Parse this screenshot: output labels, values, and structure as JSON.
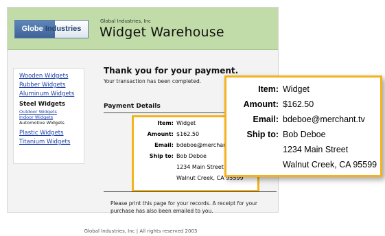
{
  "header": {
    "logo_word1": "Globe",
    "logo_word2": "Industries",
    "company": "Global Industries, Inc",
    "site_title": "Widget Warehouse"
  },
  "sidebar": {
    "items": [
      {
        "label": "Wooden Widgets"
      },
      {
        "label": "Rubber Widgets"
      },
      {
        "label": "Aluminum Widgets"
      }
    ],
    "current_group": "Steel Widgets",
    "subitems": [
      {
        "label": "Outdoor Widgets"
      },
      {
        "label": "Indoor Widgets"
      }
    ],
    "current_sub": "Automotive Widgets",
    "more_items": [
      {
        "label": "Plastic Widgets"
      },
      {
        "label": "Titanium Widgets"
      }
    ]
  },
  "main": {
    "thanks": "Thank you for your payment.",
    "completed": "Your transaction has been completed.",
    "payment_heading": "Payment Details",
    "print_note": "Please print this page for your records. A receipt for your purchase has also been emailed to you."
  },
  "payment": {
    "item_label": "Item:",
    "item_value": "Widget",
    "amount_label": "Amount:",
    "amount_value": "$162.50",
    "email_label": "Email:",
    "email_value": "bdeboe@merchant.tv",
    "ship_label": "Ship to:",
    "ship_name": "Bob Deboe",
    "ship_street": "1234 Main Street",
    "ship_city": "Walnut Creek, CA 95599"
  },
  "footer": "Global Industries, Inc | All rights reserved 2003",
  "colors": {
    "header_bg": "#c1dca8",
    "highlight_border": "#f4b31c",
    "link": "#1a3ea8"
  }
}
